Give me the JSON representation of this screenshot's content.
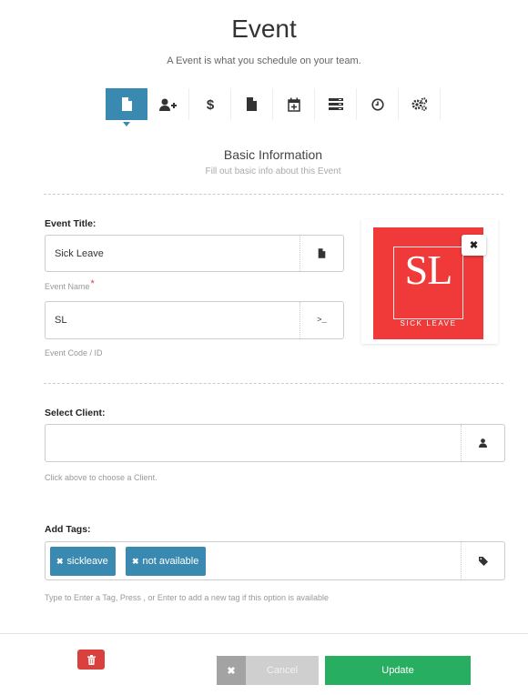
{
  "header": {
    "title": "Event",
    "subtitle": "A Event is what you schedule on your team."
  },
  "steps": [
    {
      "icon": "document-icon",
      "active": true
    },
    {
      "icon": "add-user-icon",
      "active": false
    },
    {
      "icon": "dollar-icon",
      "active": false
    },
    {
      "icon": "file-icon",
      "active": false
    },
    {
      "icon": "calendar-plus-icon",
      "active": false
    },
    {
      "icon": "list-icon",
      "active": false
    },
    {
      "icon": "clock-icon",
      "active": false
    },
    {
      "icon": "gears-icon",
      "active": false
    }
  ],
  "section": {
    "title": "Basic Information",
    "subtitle": "Fill out basic info about this Event"
  },
  "event_title": {
    "label": "Event Title:",
    "value": "Sick Leave",
    "help": "Event Name",
    "required_mark": "*"
  },
  "event_code": {
    "value": "SL",
    "help": "Event Code / ID",
    "addon": ">_"
  },
  "logo": {
    "text": "SL",
    "subtext": "SICK LEAVE",
    "remove_label": "✖",
    "color": "#f03a3a"
  },
  "client": {
    "label": "Select Client:",
    "value": "",
    "help": "Click above to choose a Client."
  },
  "tags": {
    "label": "Add Tags:",
    "items": [
      "sickleave",
      "not available"
    ],
    "remove_glyph": "✖",
    "help": "Type to Enter a Tag, Press , or Enter to add a new tag if this option is available"
  },
  "actions": {
    "cancel_label": "Cancel",
    "cancel_glyph": "✖",
    "update_label": "Update"
  },
  "colors": {
    "primary": "#3a89b0",
    "success": "#27ae60",
    "danger": "#d9413f",
    "required": "#e23b3b"
  }
}
